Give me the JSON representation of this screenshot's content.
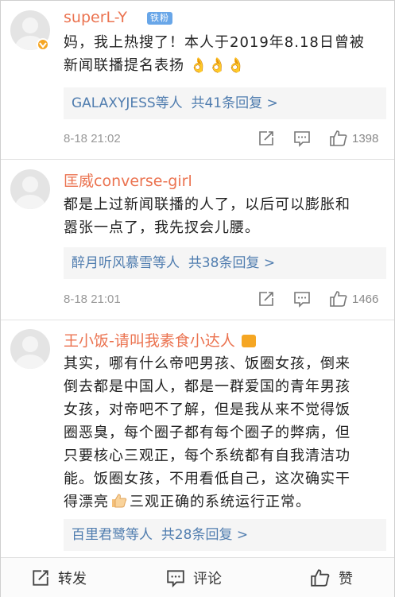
{
  "comments": [
    {
      "username": "superL-Y",
      "badge": "铁粉",
      "text_lines": [
        "妈，我上热搜了！本人于2019年8.18日曾被",
        "新闻联播提名表扬"
      ],
      "emoji": "👌👌👌",
      "reply_who": "GALAXYJESS等人",
      "reply_tail": "共41条回复 >",
      "time": "8-18 21:02",
      "likes": "1398"
    },
    {
      "username": "匡威converse-girl",
      "text_lines": [
        "都是上过新闻联播的人了，以后可以膨胀和",
        "嚣张一点了，我先扠会儿腰。"
      ],
      "reply_who": "醉月听风慕雪等人",
      "reply_tail": "共38条回复 >",
      "time": "8-18 21:01",
      "likes": "1466"
    },
    {
      "username": "王小饭-请叫我素食小达人",
      "text_lines": [
        "其实，哪有什么帝吧男孩、饭圈女孩，倒来",
        "倒去都是中国人，都是一群爱国的青年男孩",
        "女孩，对帝吧不了解，但是我从来不觉得饭",
        "圈恶臭，每个圈子都有每个圈子的弊病，但",
        "只要核心三观正，每个系统都有自我清洁功",
        "能。饭圈女孩，不用看低自己，这次确实干",
        "得漂亮"
      ],
      "last_line_tail": "三观正确的系统运行正常。",
      "reply_who": "百里君鹭等人",
      "reply_tail": "共28条回复 >"
    }
  ],
  "bottom_bar": {
    "repost": "转发",
    "comment": "评论",
    "like": "赞"
  },
  "colors": {
    "username": "#eb7350",
    "link": "#507daf",
    "text": "#222222",
    "muted": "#999999",
    "vip": "#f6a623"
  }
}
